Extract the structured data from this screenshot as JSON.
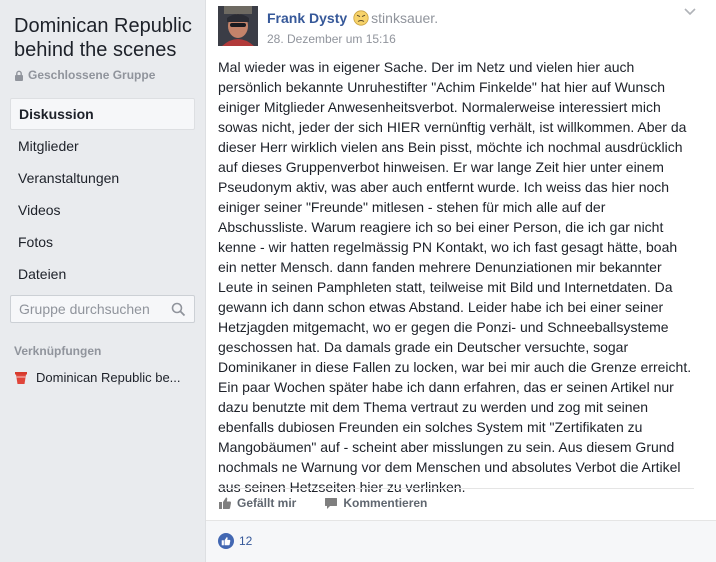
{
  "sidebar": {
    "group_title": "Dominican Republic behind the scenes",
    "privacy_label": "Geschlossene Gruppe",
    "nav": [
      {
        "label": "Diskussion",
        "active": true
      },
      {
        "label": "Mitglieder",
        "active": false
      },
      {
        "label": "Veranstaltungen",
        "active": false
      },
      {
        "label": "Videos",
        "active": false
      },
      {
        "label": "Fotos",
        "active": false
      },
      {
        "label": "Dateien",
        "active": false
      }
    ],
    "search_placeholder": "Gruppe durchsuchen",
    "links_heading": "Verknüpfungen",
    "linked_group": "Dominican Republic be..."
  },
  "post": {
    "author": "Frank Dysty",
    "feeling": "stinksauer.",
    "timestamp": "28. Dezember um 15:16",
    "body": "Mal wieder was in eigener Sache. Der im Netz und vielen hier auch persönlich bekannte Unruhestifter \"Achim Finkelde\" hat hier auf Wunsch einiger Mitglieder Anwesenheitsverbot. Normalerweise interessiert mich sowas nicht, jeder der sich HIER vernünftig verhält, ist willkommen. Aber da dieser Herr wirklich vielen ans Bein pisst, möchte ich nochmal ausdrücklich auf dieses Gruppenverbot hinweisen. Er war lange Zeit hier unter einem Pseudonym aktiv, was aber auch entfernt wurde. Ich weiss das hier noch einiger seiner \"Freunde\" mitlesen - stehen für mich alle auf der Abschussliste. Warum reagiere ich so bei einer Person, die ich gar nicht kenne - wir hatten regelmässig PN Kontakt, wo ich fast gesagt hätte, boah ein netter Mensch. dann fanden mehrere Denunziationen mir bekannter Leute in seinen Pamphleten statt, teilweise mit Bild und Internetdaten. Da gewann ich dann schon etwas Abstand. Leider habe ich bei einer seiner Hetzjagden mitgemacht, wo er gegen die Ponzi- und Schneeballsysteme geschossen hat. Da damals grade ein Deutscher versuchte, sogar Dominikaner in diese Fallen zu locken, war bei mir auch die Grenze erreicht. Ein paar Wochen später habe ich dann erfahren, das er seinen Artikel nur dazu benutzte mit dem Thema vertraut zu werden und zog mit seinen ebenfalls dubiosen Freunden ein solches System mit \"Zertifikaten zu Mangobäumen\" auf - scheint aber misslungen zu sein. Aus diesem Grund nochmals ne Warnung vor dem Menschen und absolutes Verbot die Artikel aus seinen Hetzseiten hier zu verlinken.",
    "like_label": "Gefällt mir",
    "comment_label": "Kommentieren",
    "like_count": "12"
  },
  "colors": {
    "link_blue": "#365899",
    "background": "#e9ebee",
    "like_blue": "#4267b2"
  }
}
